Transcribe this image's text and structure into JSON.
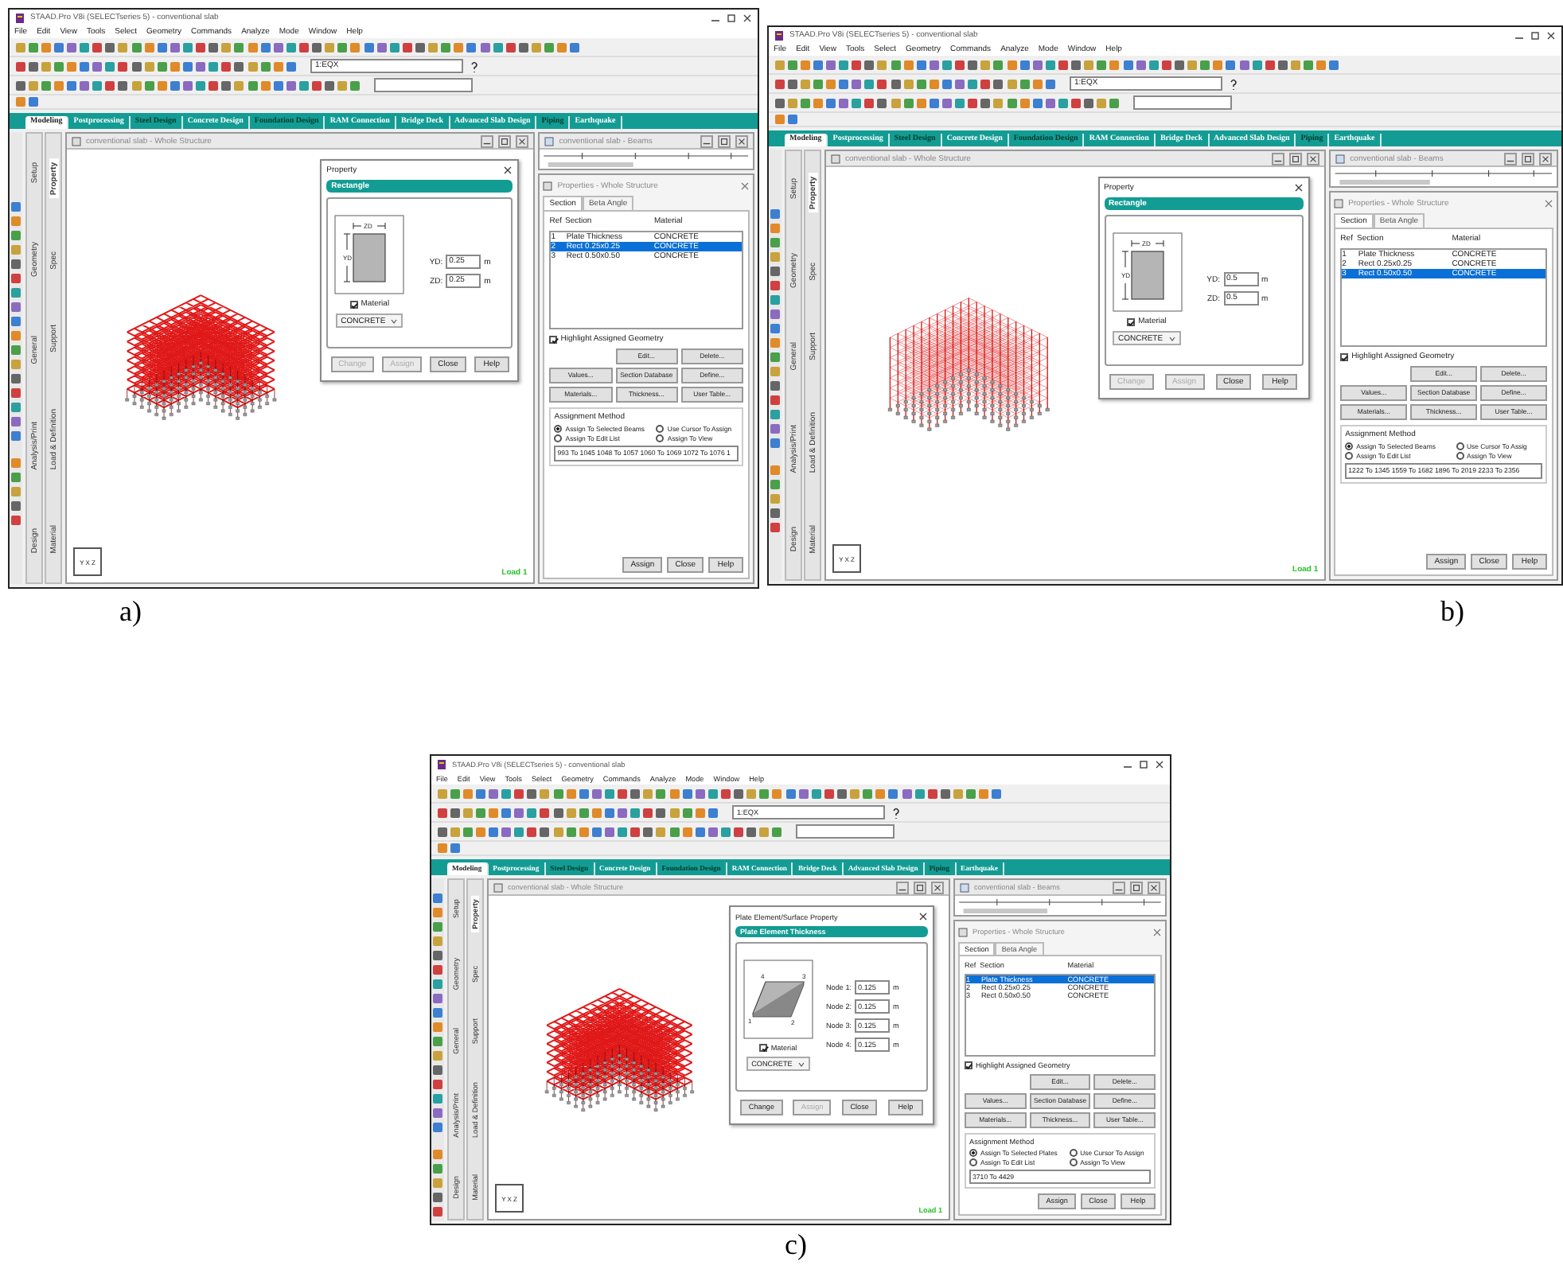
{
  "panels": [
    {
      "label": "a)",
      "title": "STAAD.Pro V8i (SELECTseries 5) - conventional slab",
      "menu": [
        "File",
        "Edit",
        "View",
        "Tools",
        "Select",
        "Geometry",
        "Commands",
        "Analyze",
        "Mode",
        "Window",
        "Help"
      ],
      "zoom_field": "1:EQX",
      "tabs": [
        {
          "label": "Modeling",
          "selected": true,
          "highlight": false
        },
        {
          "label": "Postprocessing",
          "selected": false,
          "highlight": false
        },
        {
          "label": "Steel Design",
          "selected": false,
          "highlight": true
        },
        {
          "label": "Concrete Design",
          "selected": false,
          "highlight": false
        },
        {
          "label": "Foundation Design",
          "selected": false,
          "highlight": true
        },
        {
          "label": "RAM Connection",
          "selected": false,
          "highlight": false
        },
        {
          "label": "Bridge Deck",
          "selected": false,
          "highlight": false
        },
        {
          "label": "Advanced Slab Design",
          "selected": false,
          "highlight": false
        },
        {
          "label": "Piping",
          "selected": false,
          "highlight": true
        },
        {
          "label": "Earthquake",
          "selected": false,
          "highlight": false
        }
      ],
      "side_tabs_outer": [
        "Setup",
        "Geometry",
        "General",
        "Analysis/Print",
        "Design"
      ],
      "side_tabs_inner": [
        {
          "label": "Property",
          "selected": true
        },
        {
          "label": "Spec",
          "selected": false
        },
        {
          "label": "Support",
          "selected": false
        },
        {
          "label": "Load & Definition",
          "selected": false
        },
        {
          "label": "Material",
          "selected": false
        }
      ],
      "viewport": {
        "title": "conventional slab - Whole Structure",
        "kind": "slab-grid",
        "load": "Load 1",
        "axes": [
          "Y",
          "X",
          "Z"
        ]
      },
      "dialog": {
        "title": "Property",
        "header": "Rectangle",
        "kind": "rectangle",
        "diagram_labels": [
          "ZD",
          "YD"
        ],
        "fields": [
          {
            "label": "YD:",
            "value": "0.25",
            "unit": "m"
          },
          {
            "label": "ZD:",
            "value": "0.25",
            "unit": "m"
          }
        ],
        "material": {
          "label": "Material",
          "checked": true,
          "value": "CONCRETE"
        },
        "buttons": [
          {
            "label": "Change",
            "disabled": true
          },
          {
            "label": "Assign",
            "disabled": true
          },
          {
            "label": "Close",
            "disabled": false
          },
          {
            "label": "Help",
            "disabled": false
          }
        ]
      },
      "beams_window": {
        "title": "conventional slab - Beams"
      },
      "properties": {
        "title": "Properties - Whole Structure",
        "tabs": [
          {
            "label": "Section",
            "selected": true
          },
          {
            "label": "Beta Angle",
            "selected": false
          }
        ],
        "columns": [
          "Ref",
          "Section",
          "Material"
        ],
        "rows": [
          {
            "cells": [
              "1",
              "Plate Thickness",
              "CONCRETE"
            ],
            "selected": false
          },
          {
            "cells": [
              "2",
              "Rect 0.25x0.25",
              "CONCRETE"
            ],
            "selected": true
          },
          {
            "cells": [
              "3",
              "Rect 0.50x0.50",
              "CONCRETE"
            ],
            "selected": false
          }
        ],
        "highlight": {
          "label": "Highlight Assigned Geometry",
          "checked": true
        },
        "buttons": [
          "Edit...",
          "Delete...",
          "Values...",
          "Section Database",
          "Define...",
          "Materials...",
          "Thickness...",
          "User Table..."
        ],
        "method": {
          "title": "Assignment Method",
          "options": [
            {
              "label": "Assign To Selected Beams",
              "selected": true
            },
            {
              "label": "Use Cursor To Assign",
              "selected": false
            },
            {
              "label": "Assign To Edit List",
              "selected": false
            },
            {
              "label": "Assign To View",
              "selected": false
            }
          ]
        },
        "list": "993 To 1045 1048 To 1057 1060 To 1069 1072 To 1076 1",
        "actions": [
          "Assign",
          "Close",
          "Help"
        ]
      }
    },
    {
      "label": "b)",
      "title": "STAAD.Pro V8i (SELECTseries 5) - conventional slab",
      "menu": [
        "File",
        "Edit",
        "View",
        "Tools",
        "Select",
        "Geometry",
        "Commands",
        "Analyze",
        "Mode",
        "Window",
        "Help"
      ],
      "zoom_field": "1:EQX",
      "tabs": [
        {
          "label": "Modeling",
          "selected": true,
          "highlight": false
        },
        {
          "label": "Postprocessing",
          "selected": false,
          "highlight": false
        },
        {
          "label": "Steel Design",
          "selected": false,
          "highlight": true
        },
        {
          "label": "Concrete Design",
          "selected": false,
          "highlight": false
        },
        {
          "label": "Foundation Design",
          "selected": false,
          "highlight": true
        },
        {
          "label": "RAM Connection",
          "selected": false,
          "highlight": false
        },
        {
          "label": "Bridge Deck",
          "selected": false,
          "highlight": false
        },
        {
          "label": "Advanced Slab Design",
          "selected": false,
          "highlight": false
        },
        {
          "label": "Piping",
          "selected": false,
          "highlight": true
        },
        {
          "label": "Earthquake",
          "selected": false,
          "highlight": false
        }
      ],
      "side_tabs_outer": [
        "Setup",
        "Geometry",
        "General",
        "Analysis/Print",
        "Design"
      ],
      "side_tabs_inner": [
        {
          "label": "Property",
          "selected": true
        },
        {
          "label": "Spec",
          "selected": false
        },
        {
          "label": "Support",
          "selected": false
        },
        {
          "label": "Load & Definition",
          "selected": false
        },
        {
          "label": "Material",
          "selected": false
        }
      ],
      "viewport": {
        "title": "conventional slab - Whole Structure",
        "kind": "columns",
        "load": "Load 1",
        "axes": [
          "Y",
          "X",
          "Z"
        ]
      },
      "dialog": {
        "title": "Property",
        "header": "Rectangle",
        "kind": "rectangle",
        "diagram_labels": [
          "ZD",
          "YD"
        ],
        "fields": [
          {
            "label": "YD:",
            "value": "0.5",
            "unit": "m"
          },
          {
            "label": "ZD:",
            "value": "0.5",
            "unit": "m"
          }
        ],
        "material": {
          "label": "Material",
          "checked": true,
          "value": "CONCRETE"
        },
        "buttons": [
          {
            "label": "Change",
            "disabled": true
          },
          {
            "label": "Assign",
            "disabled": true
          },
          {
            "label": "Close",
            "disabled": false
          },
          {
            "label": "Help",
            "disabled": false
          }
        ]
      },
      "beams_window": {
        "title": "conventional slab - Beams"
      },
      "properties": {
        "title": "Properties - Whole Structure",
        "tabs": [
          {
            "label": "Section",
            "selected": true
          },
          {
            "label": "Beta Angle",
            "selected": false
          }
        ],
        "columns": [
          "Ref",
          "Section",
          "Material"
        ],
        "rows": [
          {
            "cells": [
              "1",
              "Plate Thickness",
              "CONCRETE"
            ],
            "selected": false
          },
          {
            "cells": [
              "2",
              "Rect 0.25x0.25",
              "CONCRETE"
            ],
            "selected": false
          },
          {
            "cells": [
              "3",
              "Rect 0.50x0.50",
              "CONCRETE"
            ],
            "selected": true
          }
        ],
        "highlight": {
          "label": "Highlight Assigned Geometry",
          "checked": true
        },
        "buttons": [
          "Edit...",
          "Delete...",
          "Values...",
          "Section Database",
          "Define...",
          "Materials...",
          "Thickness...",
          "User Table..."
        ],
        "method": {
          "title": "Assignment Method",
          "options": [
            {
              "label": "Assign To Selected Beams",
              "selected": true
            },
            {
              "label": "Use Cursor To Assig",
              "selected": false
            },
            {
              "label": "Assign To Edit List",
              "selected": false
            },
            {
              "label": "Assign To View",
              "selected": false
            }
          ]
        },
        "list": "1222 To 1345 1559 To 1682 1896 To 2019 2233 To 2356",
        "actions": [
          "Assign",
          "Close",
          "Help"
        ]
      }
    },
    {
      "label": "c)",
      "title": "STAAD.Pro V8i (SELECTseries 5) - conventional slab",
      "menu": [
        "File",
        "Edit",
        "View",
        "Tools",
        "Select",
        "Geometry",
        "Commands",
        "Analyze",
        "Mode",
        "Window",
        "Help"
      ],
      "zoom_field": "1:EQX",
      "tabs": [
        {
          "label": "Modeling",
          "selected": true,
          "highlight": false
        },
        {
          "label": "Postprocessing",
          "selected": false,
          "highlight": false
        },
        {
          "label": "Steel Design",
          "selected": false,
          "highlight": true
        },
        {
          "label": "Concrete Design",
          "selected": false,
          "highlight": false
        },
        {
          "label": "Foundation Design",
          "selected": false,
          "highlight": true
        },
        {
          "label": "RAM Connection",
          "selected": false,
          "highlight": false
        },
        {
          "label": "Bridge Deck",
          "selected": false,
          "highlight": false
        },
        {
          "label": "Advanced Slab Design",
          "selected": false,
          "highlight": false
        },
        {
          "label": "Piping",
          "selected": false,
          "highlight": true
        },
        {
          "label": "Earthquake",
          "selected": false,
          "highlight": false
        }
      ],
      "side_tabs_outer": [
        "Setup",
        "Geometry",
        "General",
        "Analysis/Print",
        "Design"
      ],
      "side_tabs_inner": [
        {
          "label": "Property",
          "selected": true
        },
        {
          "label": "Spec",
          "selected": false
        },
        {
          "label": "Support",
          "selected": false
        },
        {
          "label": "Load & Definition",
          "selected": false
        },
        {
          "label": "Material",
          "selected": false
        }
      ],
      "viewport": {
        "title": "conventional slab - Whole Structure",
        "kind": "slab-grid",
        "load": "Load 1",
        "axes": [
          "Y",
          "X",
          "Z"
        ]
      },
      "dialog": {
        "title": "Plate Element/Surface Property",
        "header": "Plate Element Thickness",
        "kind": "plate",
        "diagram_labels": [
          "4",
          "3",
          "1",
          "2"
        ],
        "fields": [
          {
            "label": "Node 1:",
            "value": "0.125",
            "unit": "m"
          },
          {
            "label": "Node 2:",
            "value": "0.125",
            "unit": "m"
          },
          {
            "label": "Node 3:",
            "value": "0.125",
            "unit": "m"
          },
          {
            "label": "Node 4:",
            "value": "0.125",
            "unit": "m"
          }
        ],
        "material": {
          "label": "Material",
          "checked": true,
          "value": "CONCRETE"
        },
        "buttons": [
          {
            "label": "Change",
            "disabled": false
          },
          {
            "label": "Assign",
            "disabled": true
          },
          {
            "label": "Close",
            "disabled": false
          },
          {
            "label": "Help",
            "disabled": false
          }
        ]
      },
      "beams_window": {
        "title": "conventional slab - Beams"
      },
      "properties": {
        "title": "Properties - Whole Structure",
        "tabs": [
          {
            "label": "Section",
            "selected": true
          },
          {
            "label": "Beta Angle",
            "selected": false
          }
        ],
        "columns": [
          "Ref",
          "Section",
          "Material"
        ],
        "rows": [
          {
            "cells": [
              "1",
              "Plate Thickness",
              "CONCRETE"
            ],
            "selected": true
          },
          {
            "cells": [
              "2",
              "Rect 0.25x0.25",
              "CONCRETE"
            ],
            "selected": false
          },
          {
            "cells": [
              "3",
              "Rect 0.50x0.50",
              "CONCRETE"
            ],
            "selected": false
          }
        ],
        "highlight": {
          "label": "Highlight Assigned Geometry",
          "checked": true
        },
        "buttons": [
          "Edit...",
          "Delete...",
          "Values...",
          "Section Database",
          "Define...",
          "Materials...",
          "Thickness...",
          "User Table..."
        ],
        "method": {
          "title": "Assignment Method",
          "options": [
            {
              "label": "Assign To Selected Plates",
              "selected": true
            },
            {
              "label": "Use Cursor To Assign",
              "selected": false
            },
            {
              "label": "Assign To Edit List",
              "selected": false
            },
            {
              "label": "Assign To View",
              "selected": false
            }
          ]
        },
        "list": "3710 To 4429",
        "actions": [
          "Assign",
          "Close",
          "Help"
        ]
      }
    }
  ]
}
